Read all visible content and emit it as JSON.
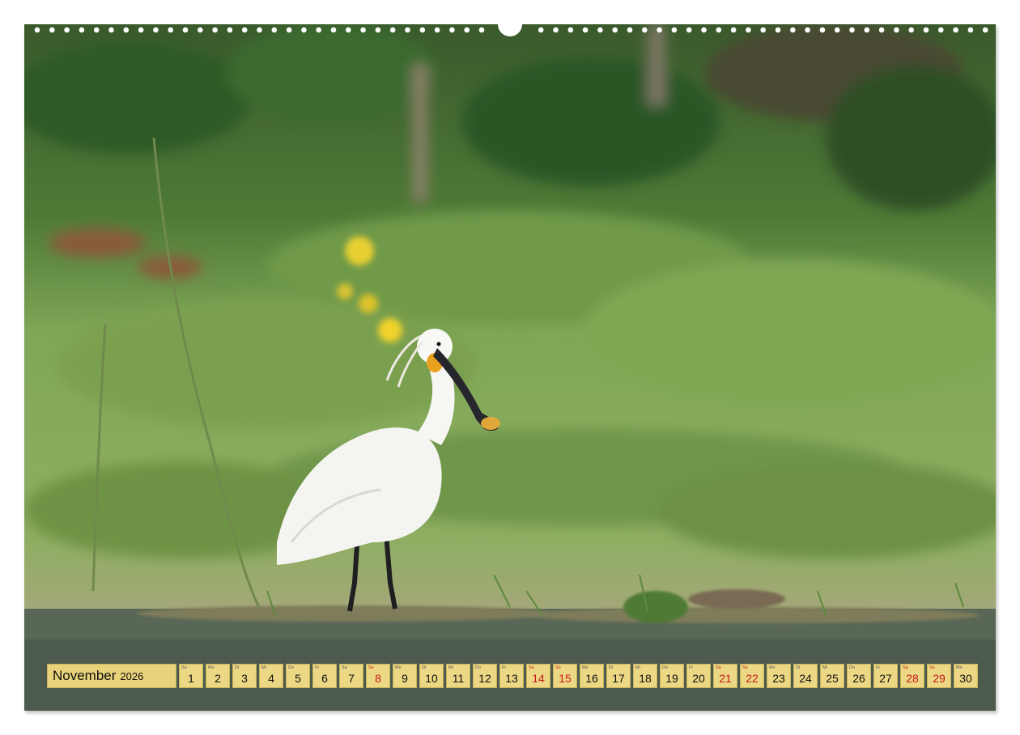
{
  "calendar": {
    "month": "November",
    "year": "2026",
    "days": [
      {
        "wd": "So",
        "n": "1",
        "red": false
      },
      {
        "wd": "Mo",
        "n": "2",
        "red": false
      },
      {
        "wd": "Di",
        "n": "3",
        "red": false
      },
      {
        "wd": "Mi",
        "n": "4",
        "red": false
      },
      {
        "wd": "Do",
        "n": "5",
        "red": false
      },
      {
        "wd": "Fr",
        "n": "6",
        "red": false
      },
      {
        "wd": "Sa",
        "n": "7",
        "red": false
      },
      {
        "wd": "So",
        "n": "8",
        "red": true
      },
      {
        "wd": "Mo",
        "n": "9",
        "red": false
      },
      {
        "wd": "Di",
        "n": "10",
        "red": false
      },
      {
        "wd": "Mi",
        "n": "11",
        "red": false
      },
      {
        "wd": "Do",
        "n": "12",
        "red": false
      },
      {
        "wd": "Fr",
        "n": "13",
        "red": false
      },
      {
        "wd": "Sa",
        "n": "14",
        "red": true
      },
      {
        "wd": "So",
        "n": "15",
        "red": true
      },
      {
        "wd": "Mo",
        "n": "16",
        "red": false
      },
      {
        "wd": "Di",
        "n": "17",
        "red": false
      },
      {
        "wd": "Mi",
        "n": "18",
        "red": false
      },
      {
        "wd": "Do",
        "n": "19",
        "red": false
      },
      {
        "wd": "Fr",
        "n": "20",
        "red": false
      },
      {
        "wd": "Sa",
        "n": "21",
        "red": true
      },
      {
        "wd": "So",
        "n": "22",
        "red": true
      },
      {
        "wd": "Mo",
        "n": "23",
        "red": false
      },
      {
        "wd": "Di",
        "n": "24",
        "red": false
      },
      {
        "wd": "Mi",
        "n": "25",
        "red": false
      },
      {
        "wd": "Do",
        "n": "26",
        "red": false
      },
      {
        "wd": "Fr",
        "n": "27",
        "red": false
      },
      {
        "wd": "Sa",
        "n": "28",
        "red": true
      },
      {
        "wd": "So",
        "n": "29",
        "red": true
      },
      {
        "wd": "Mo",
        "n": "30",
        "red": false
      }
    ]
  },
  "colors": {
    "weekend_red": "#c8191b",
    "cell_yellow": "#ecd784"
  }
}
